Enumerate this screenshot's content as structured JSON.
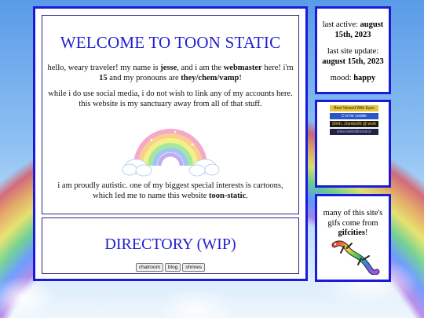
{
  "welcome": {
    "title": "WELCOME TO TOON STATIC",
    "p1_a": "hello, weary traveler! my name is ",
    "p1_name": "jesse",
    "p1_b": ", and i am the ",
    "p1_role": "webmaster",
    "p1_c": " here! i'm ",
    "p1_age": "15",
    "p1_d": " and my pronouns are ",
    "p1_pronouns": "they/chem/vamp",
    "p1_e": "!",
    "p2": "while i do use social media, i do not wish to link any of my accounts here. this website is my sanctuary away from all of that stuff.",
    "p3_a": "i am proudly autistic. one of my biggest special interests is cartoons, which led me to name this website ",
    "p3_site": "toon-static",
    "p3_b": "."
  },
  "directory": {
    "title": "DIRECTORY (WIP)",
    "buttons": [
      "chatroom",
      "blog",
      "shrines"
    ]
  },
  "status": {
    "last_active_label": "last active: ",
    "last_active_value": "august 15th, 2023",
    "last_update_label": "last site update: ",
    "last_update_value": "august 15th, 2023",
    "mood_label": "mood: ",
    "mood_value": "happy"
  },
  "badges": [
    {
      "text": "Best Viewed With Eyes",
      "bg": "#e8c43a",
      "fg": "#222"
    },
    {
      "text": "C is for cookie",
      "bg": "#2a56c8",
      "fg": "#ffffff"
    },
    {
      "text": "Shhh...Dumbo66 @ work",
      "bg": "#1c1c1c",
      "fg": "#ffd23c"
    },
    {
      "text": "www.websitesource",
      "bg": "#222244",
      "fg": "#9fb6ff"
    }
  ],
  "gifs_note": {
    "text_a": "many of this site's gifs come from ",
    "source": "gifcities",
    "text_b": "!"
  }
}
